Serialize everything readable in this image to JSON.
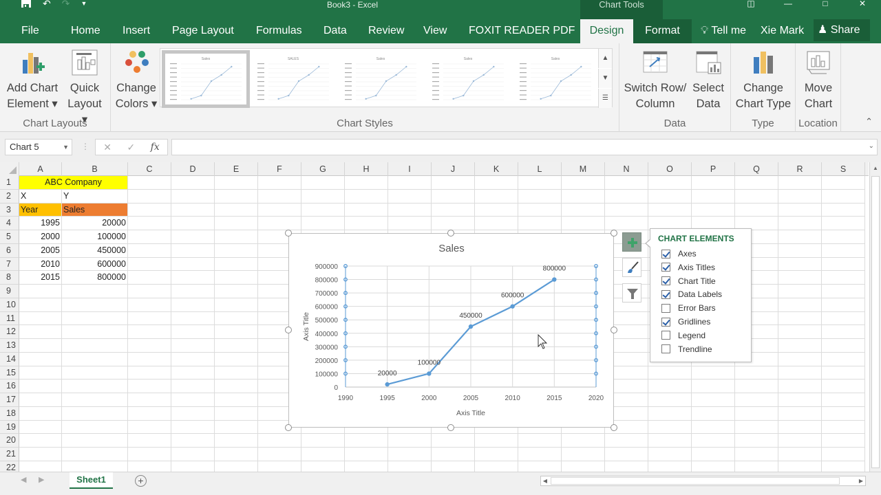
{
  "window": {
    "title": "Book3 - Excel",
    "context_tab_group": "Chart Tools",
    "qat": {
      "save_icon": "save-icon",
      "undo_icon": "undo-icon",
      "redo_icon": "redo-icon",
      "customize_icon": "chevron-down-icon"
    },
    "controls": {
      "restore_ribbon_icon": "ribbon-display-icon",
      "minimize_icon": "minimize-icon",
      "maximize_icon": "maximize-icon",
      "close_icon": "close-icon"
    }
  },
  "tabs": [
    {
      "label": "File"
    },
    {
      "label": "Home"
    },
    {
      "label": "Insert"
    },
    {
      "label": "Page Layout"
    },
    {
      "label": "Formulas"
    },
    {
      "label": "Data"
    },
    {
      "label": "Review"
    },
    {
      "label": "View"
    },
    {
      "label": "FOXIT READER PDF"
    },
    {
      "label": "Design"
    },
    {
      "label": "Format"
    }
  ],
  "active_tab": "Design",
  "tell_me": "Tell me",
  "user": "Xie Mark",
  "share": "Share",
  "ribbon": {
    "chart_layouts": {
      "label": "Chart Layouts",
      "add_chart_element": {
        "line1": "Add Chart",
        "line2": "Element ▾"
      },
      "quick_layout": {
        "line1": "Quick",
        "line2": "Layout ▾"
      }
    },
    "change_colors": {
      "line1": "Change",
      "line2": "Colors ▾"
    },
    "chart_styles": {
      "label": "Chart Styles",
      "thumbnails": [
        "Sales",
        "SALES",
        "Sales",
        "Sales",
        "Sales"
      ],
      "selected_index": 0
    },
    "data": {
      "label": "Data",
      "switch_row_column": {
        "line1": "Switch Row/",
        "line2": "Column"
      },
      "select_data": {
        "line1": "Select",
        "line2": "Data"
      }
    },
    "type": {
      "label": "Type",
      "change_chart_type": {
        "line1": "Change",
        "line2": "Chart Type"
      }
    },
    "location": {
      "label": "Location",
      "move_chart": {
        "line1": "Move",
        "line2": "Chart"
      }
    }
  },
  "formula_bar": {
    "name_box": "Chart 5",
    "cancel": "✕",
    "enter": "✓",
    "fx": "fx",
    "value": ""
  },
  "columns": [
    "A",
    "B",
    "C",
    "D",
    "E",
    "F",
    "G",
    "H",
    "I",
    "J",
    "K",
    "L",
    "M",
    "N",
    "O",
    "P",
    "Q",
    "R",
    "S"
  ],
  "rows": [
    "1",
    "2",
    "3",
    "4",
    "5",
    "6",
    "7",
    "8",
    "9",
    "10",
    "11",
    "12",
    "13",
    "14",
    "15",
    "16",
    "17",
    "18",
    "19",
    "20",
    "21",
    "22"
  ],
  "cells": {
    "A1": "ABC Company",
    "A2": "X",
    "B2": "Y",
    "A3": "Year",
    "B3": "Sales",
    "A4": "1995",
    "B4": "20000",
    "A5": "2000",
    "B5": "100000",
    "A6": "2005",
    "B6": "450000",
    "A7": "2010",
    "B7": "600000",
    "A8": "2015",
    "B8": "800000"
  },
  "colors": {
    "accent": "#217346",
    "header_yellow": "#ffff00",
    "year_orange": "#ffc000",
    "sales_orange": "#ed7d31",
    "series": "#5b9bd5"
  },
  "chart_data": {
    "type": "scatter",
    "title": "Sales",
    "xlabel": "Axis Title",
    "ylabel": "Axis Title",
    "x": [
      1995,
      2000,
      2005,
      2010,
      2015
    ],
    "series": [
      {
        "name": "Sales",
        "values": [
          20000,
          100000,
          450000,
          600000,
          800000
        ]
      }
    ],
    "data_labels": [
      "20000",
      "100000",
      "450000",
      "600000",
      "800000"
    ],
    "xlim": [
      1990,
      2020
    ],
    "ylim": [
      0,
      900000
    ],
    "xticks": [
      "1990",
      "1995",
      "2000",
      "2005",
      "2010",
      "2015",
      "2020"
    ],
    "yticks": [
      "0",
      "100000",
      "200000",
      "300000",
      "400000",
      "500000",
      "600000",
      "700000",
      "800000",
      "900000"
    ],
    "grid": true,
    "legend": "none",
    "lines_connected": true
  },
  "chart_elements": {
    "title": "CHART ELEMENTS",
    "items": [
      {
        "label": "Axes",
        "checked": true
      },
      {
        "label": "Axis Titles",
        "checked": true
      },
      {
        "label": "Chart Title",
        "checked": true
      },
      {
        "label": "Data Labels",
        "checked": true
      },
      {
        "label": "Error Bars",
        "checked": false
      },
      {
        "label": "Gridlines",
        "checked": true
      },
      {
        "label": "Legend",
        "checked": false
      },
      {
        "label": "Trendline",
        "checked": false
      }
    ]
  },
  "side_buttons": [
    "chart-elements-icon",
    "chart-styles-icon",
    "chart-filters-icon"
  ],
  "sheets": [
    {
      "name": "Sheet1"
    }
  ],
  "add_sheet": "+"
}
